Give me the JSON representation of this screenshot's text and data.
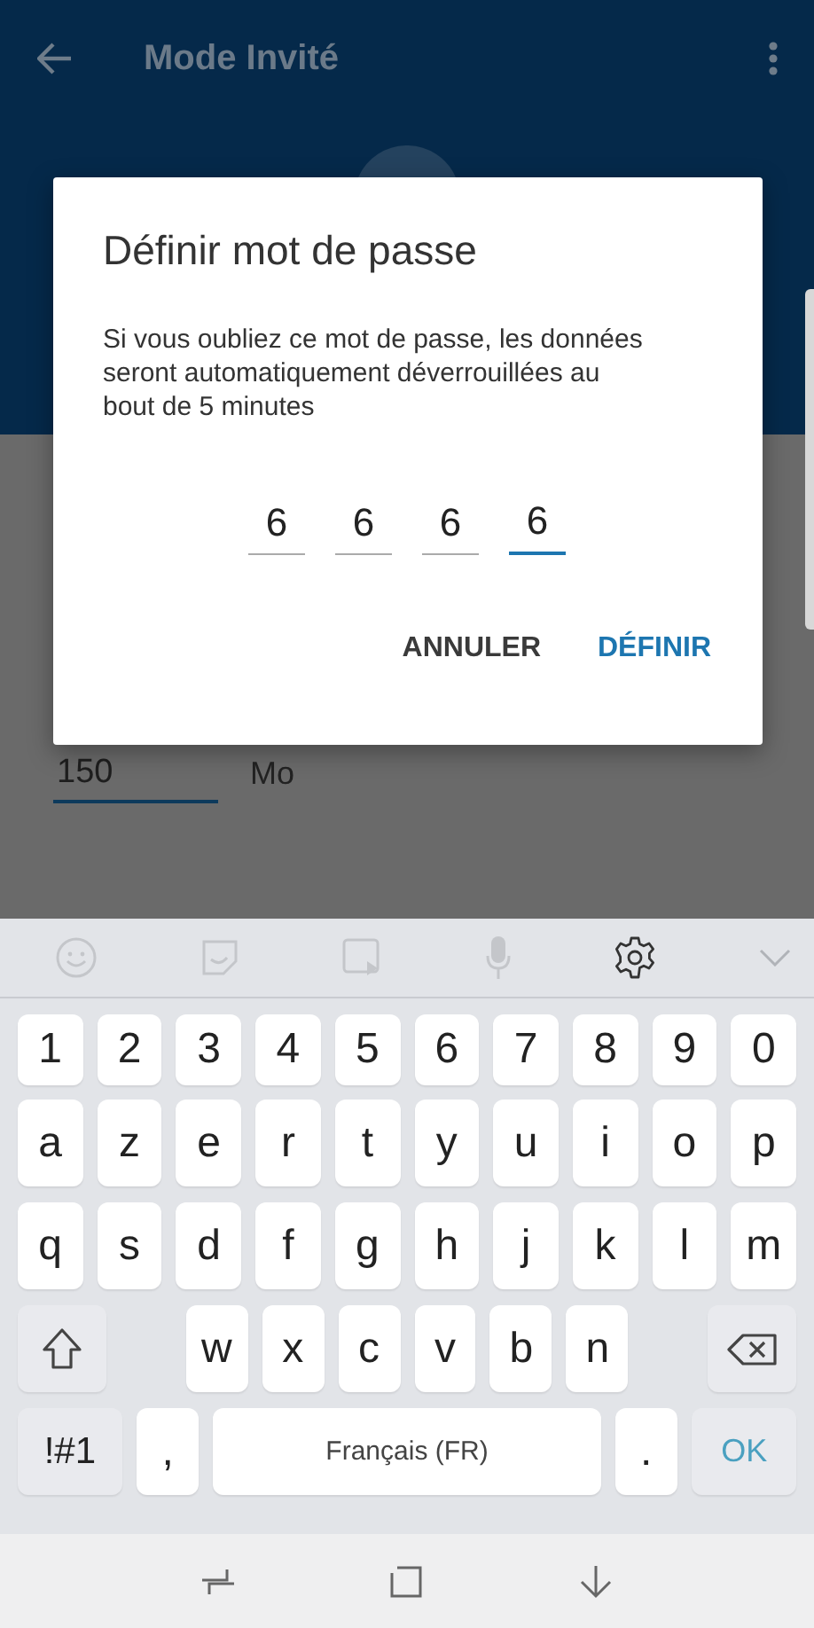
{
  "app_bar": {
    "title": "Mode Invité"
  },
  "background": {
    "size_field": {
      "value": "150"
    },
    "unit": "Mo"
  },
  "dialog": {
    "title": "Définir mot de passe",
    "message": "Si vous oubliez ce mot de passe, les données seront automatiquement déverrouillées au bout de 5 minutes",
    "pin": [
      {
        "digit": "6",
        "focused": false
      },
      {
        "digit": "6",
        "focused": false
      },
      {
        "digit": "6",
        "focused": false
      },
      {
        "digit": "6",
        "focused": true
      }
    ],
    "buttons": [
      {
        "label": "ANNULER",
        "kind": "neutral"
      },
      {
        "label": "DÉFINIR",
        "kind": "primary"
      }
    ]
  },
  "keyboard": {
    "rows": [
      [
        {
          "kind": "char",
          "label": "1"
        },
        {
          "kind": "char",
          "label": "2"
        },
        {
          "kind": "char",
          "label": "3"
        },
        {
          "kind": "char",
          "label": "4"
        },
        {
          "kind": "char",
          "label": "5"
        },
        {
          "kind": "char",
          "label": "6"
        },
        {
          "kind": "char",
          "label": "7"
        },
        {
          "kind": "char",
          "label": "8"
        },
        {
          "kind": "char",
          "label": "9"
        },
        {
          "kind": "char",
          "label": "0"
        }
      ],
      [
        {
          "kind": "char",
          "label": "a"
        },
        {
          "kind": "char",
          "label": "z"
        },
        {
          "kind": "char",
          "label": "e"
        },
        {
          "kind": "char",
          "label": "r"
        },
        {
          "kind": "char",
          "label": "t"
        },
        {
          "kind": "char",
          "label": "y"
        },
        {
          "kind": "char",
          "label": "u"
        },
        {
          "kind": "char",
          "label": "i"
        },
        {
          "kind": "char",
          "label": "o"
        },
        {
          "kind": "char",
          "label": "p"
        }
      ],
      [
        {
          "kind": "char",
          "label": "q"
        },
        {
          "kind": "char",
          "label": "s"
        },
        {
          "kind": "char",
          "label": "d"
        },
        {
          "kind": "char",
          "label": "f"
        },
        {
          "kind": "char",
          "label": "g"
        },
        {
          "kind": "char",
          "label": "h"
        },
        {
          "kind": "char",
          "label": "j"
        },
        {
          "kind": "char",
          "label": "k"
        },
        {
          "kind": "char",
          "label": "l"
        },
        {
          "kind": "char",
          "label": "m"
        }
      ],
      [
        {
          "kind": "shift"
        },
        {
          "kind": "gap"
        },
        {
          "kind": "char",
          "label": "w"
        },
        {
          "kind": "char",
          "label": "x"
        },
        {
          "kind": "char",
          "label": "c"
        },
        {
          "kind": "char",
          "label": "v"
        },
        {
          "kind": "char",
          "label": "b"
        },
        {
          "kind": "char",
          "label": "n"
        },
        {
          "kind": "gap"
        },
        {
          "kind": "backspace"
        }
      ]
    ],
    "bottom_row": [
      {
        "kind": "symbols",
        "label": "!#1"
      },
      {
        "kind": "char",
        "label": ","
      },
      {
        "kind": "space",
        "label": "Français (FR)"
      },
      {
        "kind": "char",
        "label": "."
      },
      {
        "kind": "action",
        "label": "OK"
      }
    ]
  }
}
